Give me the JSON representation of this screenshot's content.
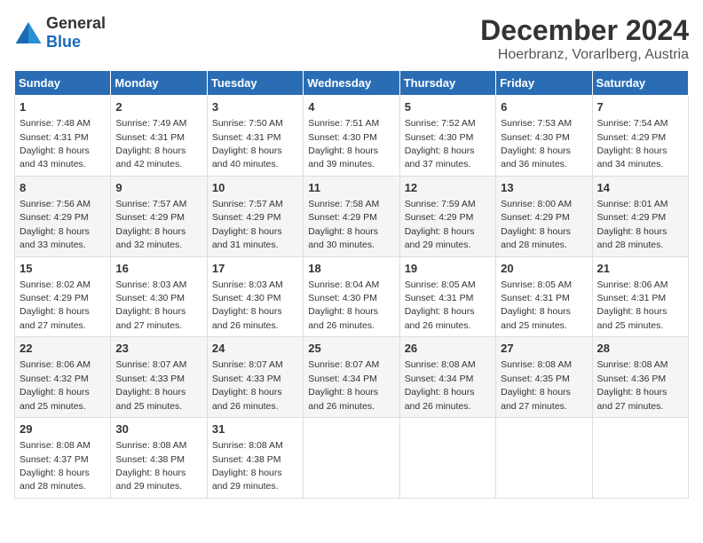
{
  "header": {
    "logo_general": "General",
    "logo_blue": "Blue",
    "title": "December 2024",
    "subtitle": "Hoerbranz, Vorarlberg, Austria"
  },
  "calendar": {
    "days_of_week": [
      "Sunday",
      "Monday",
      "Tuesday",
      "Wednesday",
      "Thursday",
      "Friday",
      "Saturday"
    ],
    "weeks": [
      [
        {
          "day": "1",
          "sunrise": "Sunrise: 7:48 AM",
          "sunset": "Sunset: 4:31 PM",
          "daylight": "Daylight: 8 hours and 43 minutes."
        },
        {
          "day": "2",
          "sunrise": "Sunrise: 7:49 AM",
          "sunset": "Sunset: 4:31 PM",
          "daylight": "Daylight: 8 hours and 42 minutes."
        },
        {
          "day": "3",
          "sunrise": "Sunrise: 7:50 AM",
          "sunset": "Sunset: 4:31 PM",
          "daylight": "Daylight: 8 hours and 40 minutes."
        },
        {
          "day": "4",
          "sunrise": "Sunrise: 7:51 AM",
          "sunset": "Sunset: 4:30 PM",
          "daylight": "Daylight: 8 hours and 39 minutes."
        },
        {
          "day": "5",
          "sunrise": "Sunrise: 7:52 AM",
          "sunset": "Sunset: 4:30 PM",
          "daylight": "Daylight: 8 hours and 37 minutes."
        },
        {
          "day": "6",
          "sunrise": "Sunrise: 7:53 AM",
          "sunset": "Sunset: 4:30 PM",
          "daylight": "Daylight: 8 hours and 36 minutes."
        },
        {
          "day": "7",
          "sunrise": "Sunrise: 7:54 AM",
          "sunset": "Sunset: 4:29 PM",
          "daylight": "Daylight: 8 hours and 34 minutes."
        }
      ],
      [
        {
          "day": "8",
          "sunrise": "Sunrise: 7:56 AM",
          "sunset": "Sunset: 4:29 PM",
          "daylight": "Daylight: 8 hours and 33 minutes."
        },
        {
          "day": "9",
          "sunrise": "Sunrise: 7:57 AM",
          "sunset": "Sunset: 4:29 PM",
          "daylight": "Daylight: 8 hours and 32 minutes."
        },
        {
          "day": "10",
          "sunrise": "Sunrise: 7:57 AM",
          "sunset": "Sunset: 4:29 PM",
          "daylight": "Daylight: 8 hours and 31 minutes."
        },
        {
          "day": "11",
          "sunrise": "Sunrise: 7:58 AM",
          "sunset": "Sunset: 4:29 PM",
          "daylight": "Daylight: 8 hours and 30 minutes."
        },
        {
          "day": "12",
          "sunrise": "Sunrise: 7:59 AM",
          "sunset": "Sunset: 4:29 PM",
          "daylight": "Daylight: 8 hours and 29 minutes."
        },
        {
          "day": "13",
          "sunrise": "Sunrise: 8:00 AM",
          "sunset": "Sunset: 4:29 PM",
          "daylight": "Daylight: 8 hours and 28 minutes."
        },
        {
          "day": "14",
          "sunrise": "Sunrise: 8:01 AM",
          "sunset": "Sunset: 4:29 PM",
          "daylight": "Daylight: 8 hours and 28 minutes."
        }
      ],
      [
        {
          "day": "15",
          "sunrise": "Sunrise: 8:02 AM",
          "sunset": "Sunset: 4:29 PM",
          "daylight": "Daylight: 8 hours and 27 minutes."
        },
        {
          "day": "16",
          "sunrise": "Sunrise: 8:03 AM",
          "sunset": "Sunset: 4:30 PM",
          "daylight": "Daylight: 8 hours and 27 minutes."
        },
        {
          "day": "17",
          "sunrise": "Sunrise: 8:03 AM",
          "sunset": "Sunset: 4:30 PM",
          "daylight": "Daylight: 8 hours and 26 minutes."
        },
        {
          "day": "18",
          "sunrise": "Sunrise: 8:04 AM",
          "sunset": "Sunset: 4:30 PM",
          "daylight": "Daylight: 8 hours and 26 minutes."
        },
        {
          "day": "19",
          "sunrise": "Sunrise: 8:05 AM",
          "sunset": "Sunset: 4:31 PM",
          "daylight": "Daylight: 8 hours and 26 minutes."
        },
        {
          "day": "20",
          "sunrise": "Sunrise: 8:05 AM",
          "sunset": "Sunset: 4:31 PM",
          "daylight": "Daylight: 8 hours and 25 minutes."
        },
        {
          "day": "21",
          "sunrise": "Sunrise: 8:06 AM",
          "sunset": "Sunset: 4:31 PM",
          "daylight": "Daylight: 8 hours and 25 minutes."
        }
      ],
      [
        {
          "day": "22",
          "sunrise": "Sunrise: 8:06 AM",
          "sunset": "Sunset: 4:32 PM",
          "daylight": "Daylight: 8 hours and 25 minutes."
        },
        {
          "day": "23",
          "sunrise": "Sunrise: 8:07 AM",
          "sunset": "Sunset: 4:33 PM",
          "daylight": "Daylight: 8 hours and 25 minutes."
        },
        {
          "day": "24",
          "sunrise": "Sunrise: 8:07 AM",
          "sunset": "Sunset: 4:33 PM",
          "daylight": "Daylight: 8 hours and 26 minutes."
        },
        {
          "day": "25",
          "sunrise": "Sunrise: 8:07 AM",
          "sunset": "Sunset: 4:34 PM",
          "daylight": "Daylight: 8 hours and 26 minutes."
        },
        {
          "day": "26",
          "sunrise": "Sunrise: 8:08 AM",
          "sunset": "Sunset: 4:34 PM",
          "daylight": "Daylight: 8 hours and 26 minutes."
        },
        {
          "day": "27",
          "sunrise": "Sunrise: 8:08 AM",
          "sunset": "Sunset: 4:35 PM",
          "daylight": "Daylight: 8 hours and 27 minutes."
        },
        {
          "day": "28",
          "sunrise": "Sunrise: 8:08 AM",
          "sunset": "Sunset: 4:36 PM",
          "daylight": "Daylight: 8 hours and 27 minutes."
        }
      ],
      [
        {
          "day": "29",
          "sunrise": "Sunrise: 8:08 AM",
          "sunset": "Sunset: 4:37 PM",
          "daylight": "Daylight: 8 hours and 28 minutes."
        },
        {
          "day": "30",
          "sunrise": "Sunrise: 8:08 AM",
          "sunset": "Sunset: 4:38 PM",
          "daylight": "Daylight: 8 hours and 29 minutes."
        },
        {
          "day": "31",
          "sunrise": "Sunrise: 8:08 AM",
          "sunset": "Sunset: 4:38 PM",
          "daylight": "Daylight: 8 hours and 29 minutes."
        },
        null,
        null,
        null,
        null
      ]
    ]
  }
}
